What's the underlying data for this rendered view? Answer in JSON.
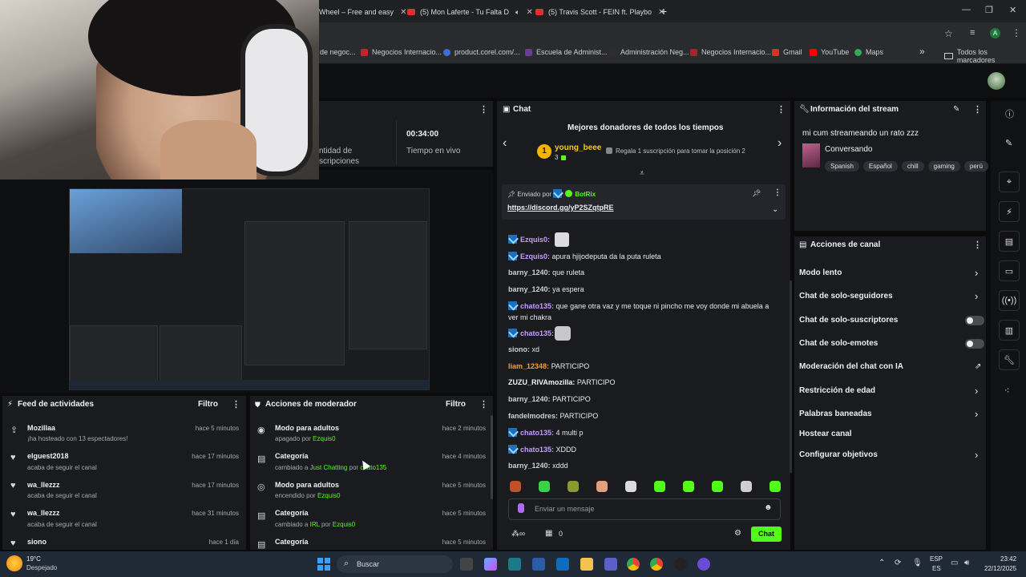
{
  "browser": {
    "tabs": [
      {
        "label": "Wheel – Free and easy"
      },
      {
        "label": "(5) Mon Laferte - Tu Falta D"
      },
      {
        "label": "(5) Travis Scott - FEIN ft. Playbo"
      }
    ],
    "new_tab": "+",
    "controls": {
      "minimize": "—",
      "restore": "❐",
      "close": "✕"
    },
    "avatar_letter": "A",
    "bookmarks": [
      {
        "label": "de negoc...",
        "color": "#555"
      },
      {
        "label": "Negocios Internacio...",
        "color": "#c0262d"
      },
      {
        "label": "product.corel.com/...",
        "color": "#3b6fd6"
      },
      {
        "label": "Escuela de Administ...",
        "color": "#6a3c9a"
      },
      {
        "label": "Administración Neg...",
        "color": "#2d2d2d"
      },
      {
        "label": "Negocios Internacio...",
        "color": "#b0202a"
      },
      {
        "label": "Gmail",
        "color": "#d93025"
      },
      {
        "label": "YouTube",
        "color": "#ff0000"
      },
      {
        "label": "Maps",
        "color": "#34a853"
      }
    ],
    "bookmarks_more": "»",
    "all_bookmarks": "Todos los marcadores"
  },
  "stats": {
    "followers_label": "ntidad de\nscripciones",
    "time_value": "00:34:00",
    "time_label": "Tiempo en vivo"
  },
  "chat": {
    "title": "Chat",
    "top_donors_title": "Mejores donadores de todos los tiempos",
    "donor_rank": "1",
    "donor_name": "young_beee",
    "donor_count": "3",
    "donor_cta": "Regala 1 suscripción para tomar la posición 2",
    "pinned_by_label": "Enviado por",
    "pinned_by_user": "BotRix",
    "pinned_link": "https://discord.gg/yP2SZqtpRE",
    "messages": [
      {
        "user": "Ezquis0:",
        "text": "",
        "cls": "u-purple",
        "badge": true
      },
      {
        "user": "Ezquis0:",
        "text": "apura hjijodeputa da la puta ruleta",
        "cls": "u-purple",
        "badge": true
      },
      {
        "user": "barny_1240:",
        "text": "que ruleta",
        "cls": "u-gray",
        "badge": false
      },
      {
        "user": "barny_1240:",
        "text": "ya espera",
        "cls": "u-gray",
        "badge": false
      },
      {
        "user": "chato135:",
        "text": "que gane otra vaz y me toque ni pincho me voy donde mi abuela a",
        "cls": "u-purple",
        "badge": true
      },
      {
        "user": "",
        "text": "ver mi chakra",
        "cls": "",
        "badge": false
      },
      {
        "user": "chato135:",
        "text": "",
        "cls": "u-purple",
        "badge": true
      },
      {
        "user": "siono:",
        "text": "xd",
        "cls": "u-gray",
        "badge": false
      },
      {
        "user": "liam_12348:",
        "text": "PARTICIPO",
        "cls": "u-orange",
        "badge": false
      },
      {
        "user": "ZUZU_RIVAmozilla:",
        "text": "PARTICIPO",
        "cls": "u-white",
        "badge": false
      },
      {
        "user": "barny_1240:",
        "text": "PARTICIPO",
        "cls": "u-gray",
        "badge": false
      },
      {
        "user": "fandelmodres:",
        "text": "PARTICIPO",
        "cls": "u-gray",
        "badge": false
      },
      {
        "user": "chato135:",
        "text": "4 multi p",
        "cls": "u-purple",
        "badge": true
      },
      {
        "user": "chato135:",
        "text": "XDDD",
        "cls": "u-purple",
        "badge": true
      },
      {
        "user": "barny_1240:",
        "text": "xddd",
        "cls": "u-gray",
        "badge": false
      }
    ],
    "input_placeholder": "Enviar un mensaje",
    "points": "0",
    "send_label": "Chat"
  },
  "stream_info": {
    "title": "Información del stream",
    "stream_title": "mi cum streameando un rato zzz",
    "category": "Conversando",
    "tags": [
      "Spanish",
      "Español",
      "chill",
      "gaming",
      "perú"
    ]
  },
  "channel_actions": {
    "title": "Acciones de canal",
    "items": [
      {
        "label": "Modo lento",
        "kind": "arrow"
      },
      {
        "label": "Chat de solo-seguidores",
        "kind": "arrow"
      },
      {
        "label": "Chat de solo-suscriptores",
        "kind": "toggle"
      },
      {
        "label": "Chat de solo-emotes",
        "kind": "toggle"
      },
      {
        "label": "Moderación del chat con IA",
        "kind": "external"
      },
      {
        "label": "Restricción de edad",
        "kind": "arrow"
      },
      {
        "label": "Palabras baneadas",
        "kind": "arrow"
      },
      {
        "label": "Hostear canal",
        "kind": "none"
      },
      {
        "label": "Configurar objetivos",
        "kind": "arrow"
      }
    ]
  },
  "activity_feed": {
    "title": "Feed de actividades",
    "filter": "Filtro",
    "rows": [
      {
        "name": "Mozillaa",
        "sub": "¡ha hosteado con 13 espectadores!",
        "time": "hace 5 minutos",
        "icon": "⇪"
      },
      {
        "name": "elguest2018",
        "sub": "acaba de seguir el canal",
        "time": "hace 17 minutos",
        "icon": "♥"
      },
      {
        "name": "wa_llezzz",
        "sub": "acaba de seguir el canal",
        "time": "hace 17 minutos",
        "icon": "♥"
      },
      {
        "name": "wa_llezzz",
        "sub": "acaba de seguir el canal",
        "time": "hace 31 minutos",
        "icon": "♥"
      },
      {
        "name": "siono",
        "sub": "",
        "time": "hace 1 día",
        "icon": "♥"
      }
    ]
  },
  "mod_actions": {
    "title": "Acciones de moderador",
    "filter": "Filtro",
    "rows": [
      {
        "name": "Modo para adultos",
        "sub_pre": "apagado por",
        "who": "Ezquis0",
        "time": "hace 2 minutos",
        "icon": "◉"
      },
      {
        "name": "Categoría",
        "sub_pre": "cambiado a",
        "value": "Just Chatting",
        "mid": "por",
        "who": "chato135",
        "time": "hace 4 minutos",
        "icon": "▤"
      },
      {
        "name": "Modo para adultos",
        "sub_pre": "encendido por",
        "who": "Ezquis0",
        "time": "hace 5 minutos",
        "icon": "◎"
      },
      {
        "name": "Categoría",
        "sub_pre": "cambiado a",
        "value": "IRL",
        "mid": "por",
        "who": "Ezquis0",
        "time": "hace 5 minutos",
        "icon": "▤"
      },
      {
        "name": "Categoría",
        "time": "hace 5 minutos",
        "icon": "▤"
      }
    ]
  },
  "taskbar": {
    "weather_temp": "19°C",
    "weather_text": "Despejado",
    "search": "Buscar",
    "lang1": "ESP",
    "lang2": "ES",
    "time": "23:42",
    "date": "22/12/2025"
  },
  "colors": {
    "accent": "#53fc18",
    "panel": "#191b1f",
    "bg": "#0b0b0c"
  }
}
